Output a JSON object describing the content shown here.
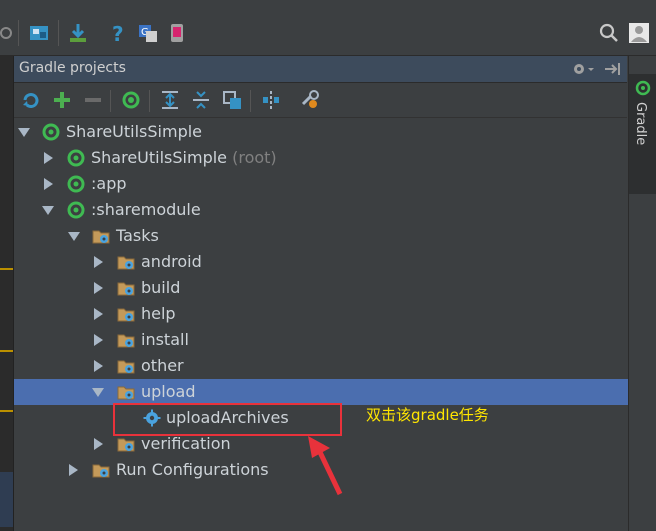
{
  "panel": {
    "title": "Gradle projects"
  },
  "side_tab": {
    "label": "Gradle"
  },
  "tree": {
    "root": {
      "label": "ShareUtilsSimple"
    },
    "root_module": {
      "label": "ShareUtilsSimple",
      "suffix": "(root)"
    },
    "app_module": {
      "label": ":app"
    },
    "sharemodule": {
      "label": ":sharemodule"
    },
    "tasks": {
      "label": "Tasks"
    },
    "task_groups": [
      "android",
      "build",
      "help",
      "install",
      "other",
      "upload",
      "verification"
    ],
    "upload_archives": {
      "label": "uploadArchives"
    },
    "run_configurations": {
      "label": "Run Configurations"
    }
  },
  "annotation": {
    "text": "双击该gradle任务"
  },
  "colors": {
    "selection": "#4b6eaf",
    "callout": "#e8323b",
    "annotation_text": "#ffe600",
    "gradle_green": "#3fba52"
  },
  "icons": [
    "refresh-icon",
    "add-icon",
    "remove-icon",
    "execute-task-icon",
    "expand-all-icon",
    "collapse-all-icon",
    "link-icon",
    "offline-icon",
    "settings-icon",
    "gear-icon",
    "hide-icon",
    "search-icon",
    "avatar"
  ]
}
